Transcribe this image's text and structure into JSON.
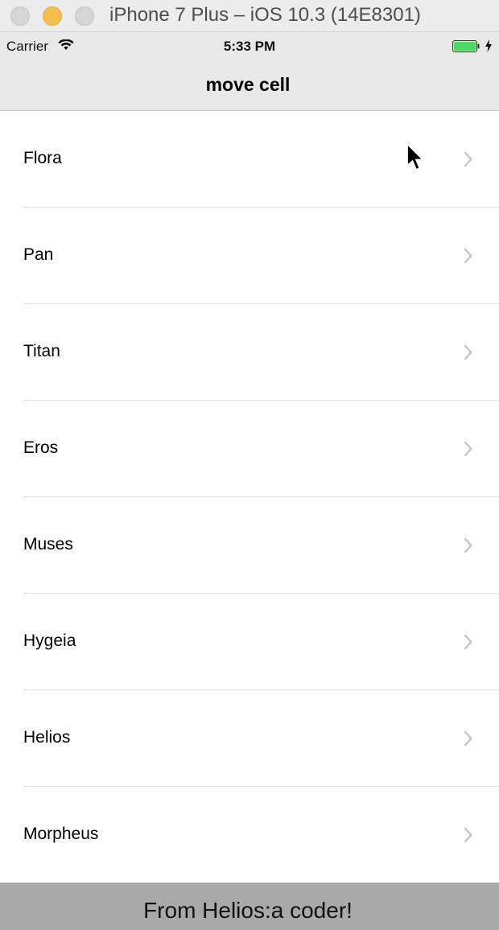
{
  "window": {
    "title": "iPhone 7 Plus – iOS 10.3 (14E8301)"
  },
  "status_bar": {
    "carrier": "Carrier",
    "time": "5:33 PM",
    "battery_color": "#4cd964"
  },
  "nav": {
    "title": "move cell"
  },
  "table": {
    "rows": [
      {
        "label": "Flora"
      },
      {
        "label": "Pan"
      },
      {
        "label": "Titan"
      },
      {
        "label": "Eros"
      },
      {
        "label": "Muses"
      },
      {
        "label": "Hygeia"
      },
      {
        "label": "Helios"
      },
      {
        "label": "Morpheus"
      }
    ]
  },
  "banner": {
    "text": "From Helios:a coder!"
  }
}
